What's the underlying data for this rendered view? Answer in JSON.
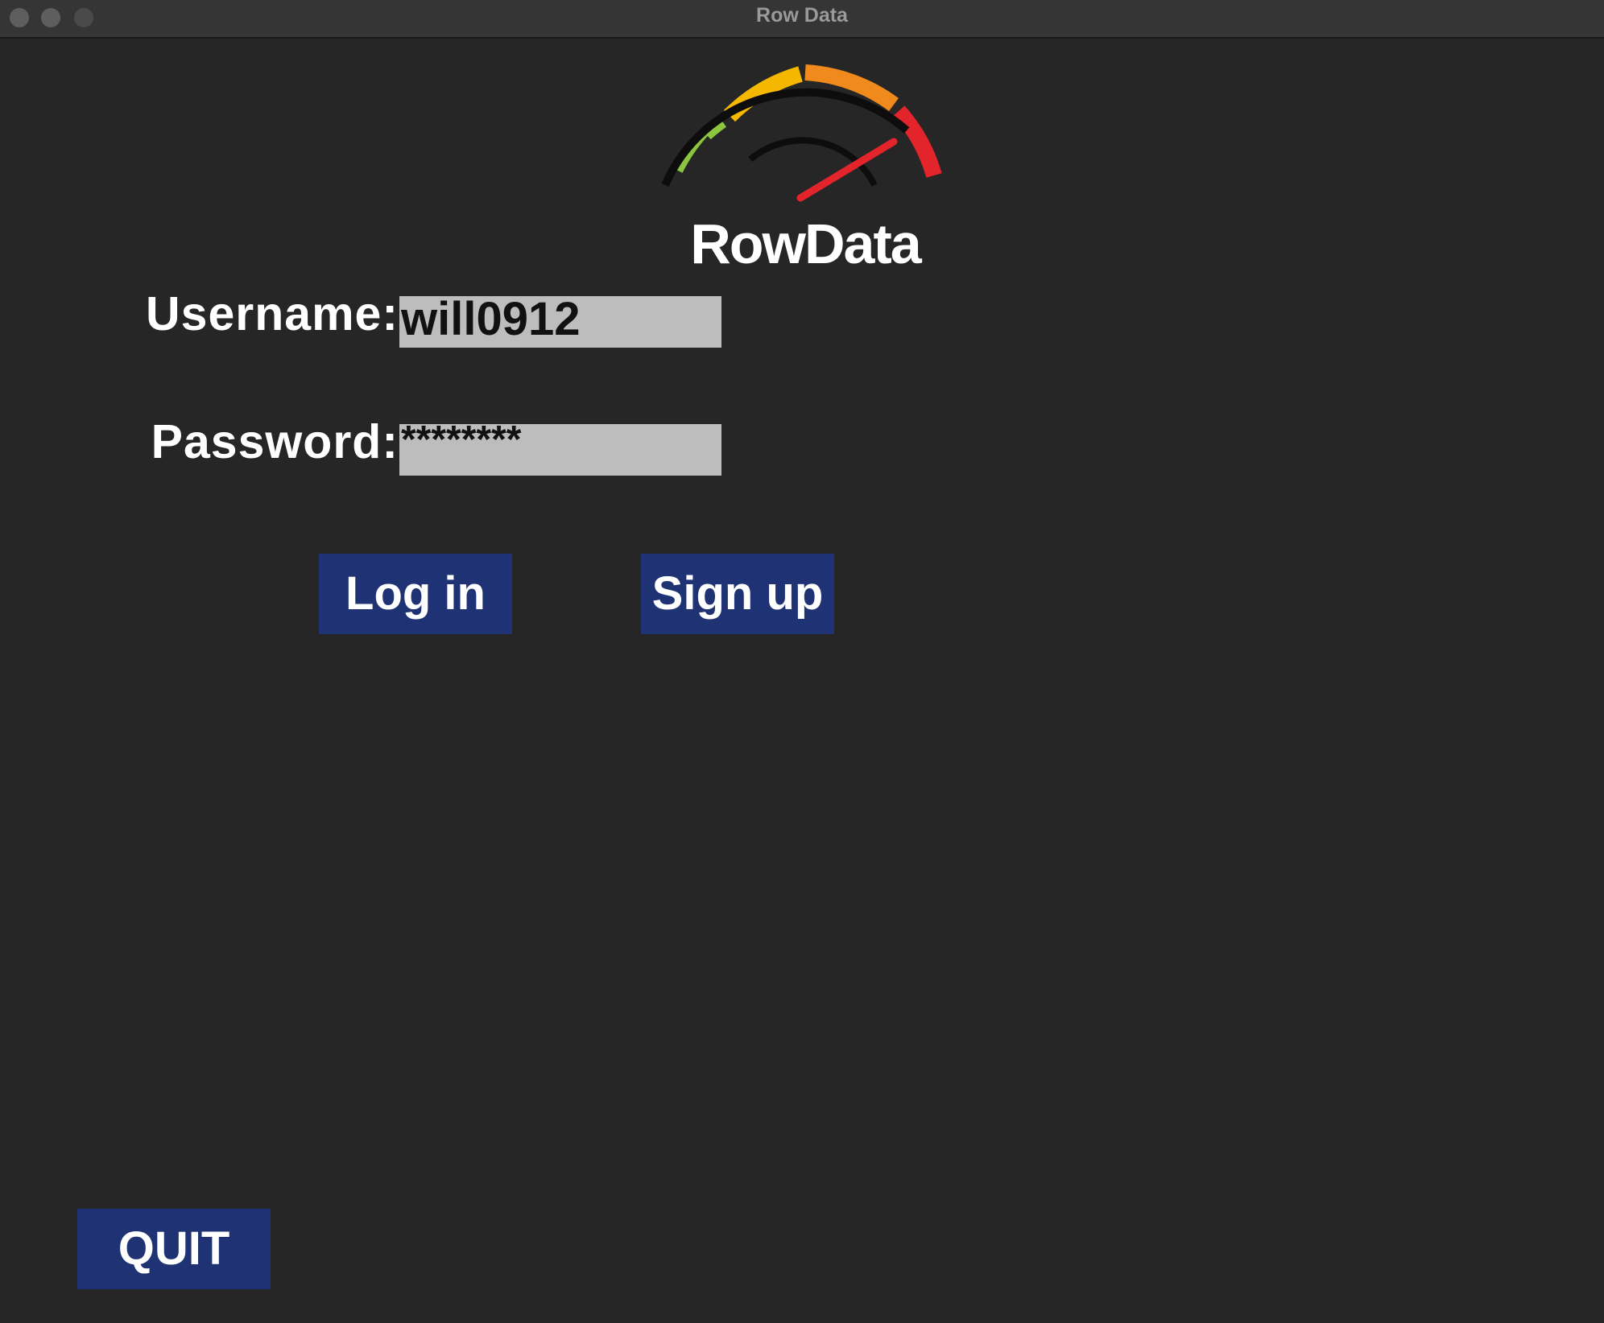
{
  "window": {
    "title": "Row Data"
  },
  "logo": {
    "text": "RowData",
    "colors": {
      "green": "#8cc63f",
      "yellow": "#f5b800",
      "orange": "#f08a1c",
      "red": "#e3242b",
      "needle": "#e3242b",
      "arc": "#111111"
    }
  },
  "form": {
    "username_label": "Username:",
    "username_value": "will0912",
    "password_label": "Password:",
    "password_value": "********"
  },
  "buttons": {
    "login": "Log in",
    "signup": "Sign up",
    "quit": "QUIT"
  },
  "colors": {
    "background": "#262626",
    "button": "#1f3374",
    "field": "#bdbdbd"
  }
}
